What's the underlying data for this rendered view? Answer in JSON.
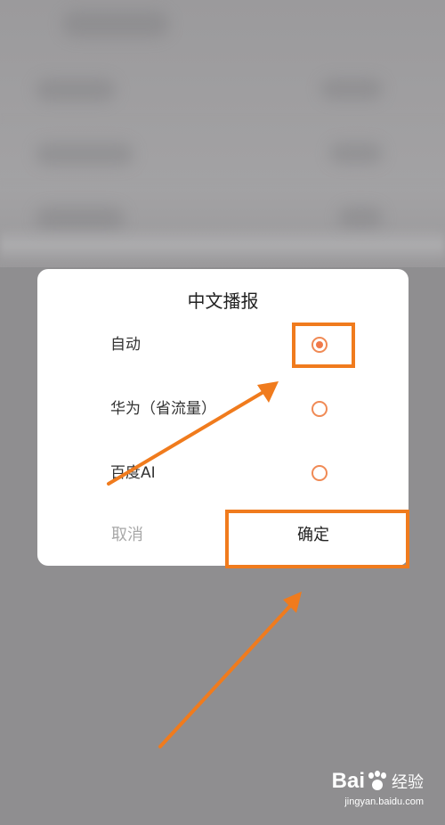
{
  "dialog": {
    "title": "中文播报",
    "options": [
      {
        "label": "自动",
        "selected": true
      },
      {
        "label": "华为（省流量）",
        "selected": false
      },
      {
        "label": "百度AI",
        "selected": false
      }
    ],
    "cancel_label": "取消",
    "confirm_label": "确定"
  },
  "colors": {
    "accent": "#f0794a",
    "annotation": "#f07b1d",
    "overlay": "#8f8e90"
  },
  "watermark": {
    "logo_text": "Bai",
    "logo_suffix": "经验",
    "url": "jingyan.baidu.com"
  }
}
